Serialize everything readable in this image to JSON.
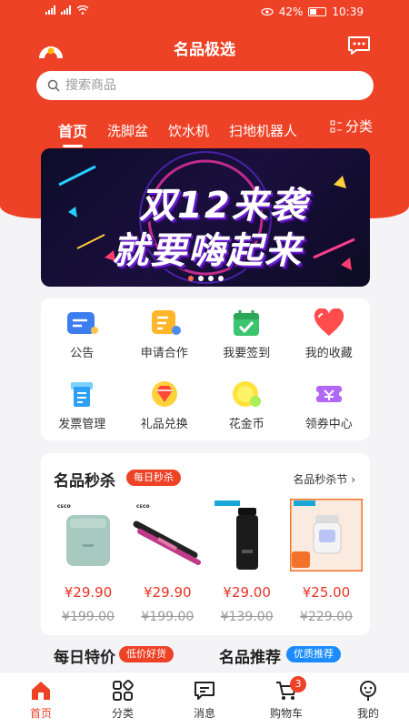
{
  "status": {
    "battery": "42%",
    "time": "10:39"
  },
  "header": {
    "title": "名品极选"
  },
  "search": {
    "placeholder": "搜索商品"
  },
  "tabs": [
    "首页",
    "洗脚盆",
    "饮水机",
    "扫地机器人"
  ],
  "tab_category": "分类",
  "banner": {
    "line1": "双12来袭",
    "line2": "就要嗨起来",
    "slides": 4,
    "active_slide": 1
  },
  "quick_menu": [
    {
      "label": "公告",
      "icon": "announcement-icon"
    },
    {
      "label": "申请合作",
      "icon": "cooperation-icon"
    },
    {
      "label": "我要签到",
      "icon": "checkin-calendar-icon"
    },
    {
      "label": "我的收藏",
      "icon": "favorite-heart-icon"
    },
    {
      "label": "发票管理",
      "icon": "invoice-icon"
    },
    {
      "label": "礼品兑换",
      "icon": "gift-diamond-icon"
    },
    {
      "label": "花金币",
      "icon": "coin-icon"
    },
    {
      "label": "领券中心",
      "icon": "coupon-icon"
    }
  ],
  "flash_sale": {
    "title": "名品秒杀",
    "tag": "每日秒杀",
    "more": "名品秒杀节",
    "products": [
      {
        "price": "¥29.90",
        "old_price": "¥199.00",
        "kind": "air-purifier"
      },
      {
        "price": "¥29.90",
        "old_price": "¥199.00",
        "kind": "hair-straightener"
      },
      {
        "price": "¥29.00",
        "old_price": "¥139.00",
        "kind": "thermos-bottle"
      },
      {
        "price": "¥25.00",
        "old_price": "¥229.00",
        "kind": "mosquito-lamp"
      }
    ]
  },
  "daily_special": {
    "title": "每日特价",
    "tag": "低价好货"
  },
  "recommend": {
    "title": "名品推荐",
    "tag": "优质推荐"
  },
  "bottom_nav": [
    {
      "label": "首页",
      "icon": "home-icon",
      "active": true
    },
    {
      "label": "分类",
      "icon": "category-grid-icon",
      "active": false
    },
    {
      "label": "消息",
      "icon": "message-icon",
      "active": false
    },
    {
      "label": "购物车",
      "icon": "cart-icon",
      "active": false,
      "badge": "3"
    },
    {
      "label": "我的",
      "icon": "profile-icon",
      "active": false
    }
  ],
  "colors": {
    "brand": "#ee4227",
    "price": "#e83325",
    "tag_red": "#ee4227",
    "tag_blue": "#1a8cff"
  }
}
